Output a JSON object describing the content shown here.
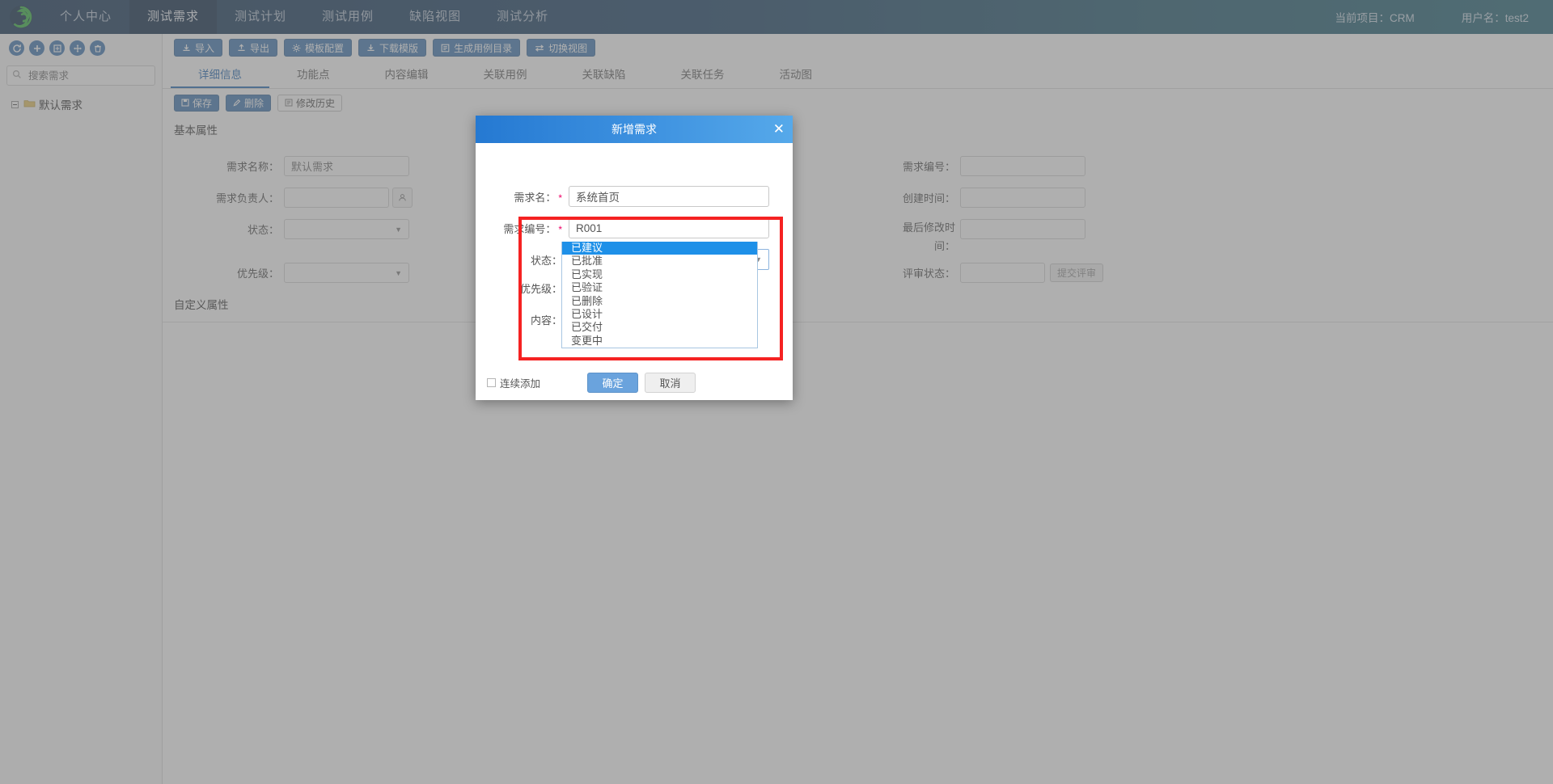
{
  "nav": {
    "logo_icon": "spiral-logo-icon",
    "items": [
      {
        "label": "个人中心",
        "active": false
      },
      {
        "label": "测试需求",
        "active": true
      },
      {
        "label": "测试计划",
        "active": false
      },
      {
        "label": "测试用例",
        "active": false
      },
      {
        "label": "缺陷视图",
        "active": false
      },
      {
        "label": "测试分析",
        "active": false
      }
    ],
    "current_project": "当前项目：CRM",
    "user": "用户名：test2"
  },
  "sidebar": {
    "tool_icons": [
      {
        "name": "refresh-icon",
        "glyph": "refresh"
      },
      {
        "name": "add-icon",
        "glyph": "plus"
      },
      {
        "name": "add-node-icon",
        "glyph": "grid-plus"
      },
      {
        "name": "move-icon",
        "glyph": "move"
      },
      {
        "name": "delete-icon",
        "glyph": "trash"
      }
    ],
    "search": {
      "placeholder": "搜索需求",
      "value": ""
    },
    "tree": [
      {
        "label": "默认需求",
        "expanded": true,
        "icon": "folder-icon"
      }
    ]
  },
  "toolbar": {
    "buttons": [
      {
        "label": "导入",
        "icon": "import-icon"
      },
      {
        "label": "导出",
        "icon": "export-icon"
      },
      {
        "label": "模板配置",
        "icon": "gear-icon"
      },
      {
        "label": "下载模版",
        "icon": "download-icon"
      },
      {
        "label": "生成用例目录",
        "icon": "list-icon"
      },
      {
        "label": "切换视图",
        "icon": "swap-icon"
      }
    ]
  },
  "tabs": [
    {
      "label": "详细信息",
      "active": true
    },
    {
      "label": "功能点",
      "active": false
    },
    {
      "label": "内容编辑",
      "active": false
    },
    {
      "label": "关联用例",
      "active": false
    },
    {
      "label": "关联缺陷",
      "active": false
    },
    {
      "label": "关联任务",
      "active": false
    },
    {
      "label": "活动图",
      "active": false
    }
  ],
  "actions": [
    {
      "label": "保存",
      "icon": "save-icon",
      "style": "primary"
    },
    {
      "label": "删除",
      "icon": "pencil-icon",
      "style": "primary"
    },
    {
      "label": "修改历史",
      "icon": "history-icon",
      "style": "light"
    }
  ],
  "detail": {
    "section_basic": "基本属性",
    "section_custom": "自定义属性",
    "fields": {
      "name_label": "需求名称：",
      "name_value": "默认需求",
      "owner_label": "需求负责人：",
      "owner_value": "",
      "status_label": "状态：",
      "status_value": "",
      "priority_label": "优先级：",
      "priority_value": "",
      "code_label": "需求编号：",
      "code_value": "",
      "created_label": "创建时间：",
      "created_value": "",
      "modified_label_line1": "最后修改时",
      "modified_label_line2": "间：",
      "modified_value": "",
      "review_label": "评审状态：",
      "review_value": "",
      "review_button": "提交评审"
    }
  },
  "dialog": {
    "title": "新增需求",
    "close_icon": "close-icon",
    "fields": {
      "name_label": "需求名：",
      "name_value": "系统首页",
      "code_label": "需求编号：",
      "code_value": "R001",
      "status_label": "状态：",
      "status_value": "已建议",
      "priority_label": "优先级：",
      "content_label": "内容："
    },
    "required_mark": "*",
    "status_options": [
      {
        "label": "已建议",
        "selected": true
      },
      {
        "label": "已批准",
        "selected": false
      },
      {
        "label": "已实现",
        "selected": false
      },
      {
        "label": "已验证",
        "selected": false
      },
      {
        "label": "已删除",
        "selected": false
      },
      {
        "label": "已设计",
        "selected": false
      },
      {
        "label": "已交付",
        "selected": false
      },
      {
        "label": "变更中",
        "selected": false
      }
    ],
    "footer": {
      "continuous_add_label": "连续添加",
      "continuous_add_checked": false,
      "ok_label": "确定",
      "cancel_label": "取消"
    }
  },
  "colors": {
    "nav_dark": "#1e3c5c",
    "nav_teal": "#2d6b7c",
    "accent_blue": "#4a7fb5",
    "dialog_header": "#2579d2",
    "dropdown_selected": "#1e90e8",
    "highlight_red": "#f52222",
    "folder_yellow": "#e8c86a",
    "required_red": "#e06"
  }
}
